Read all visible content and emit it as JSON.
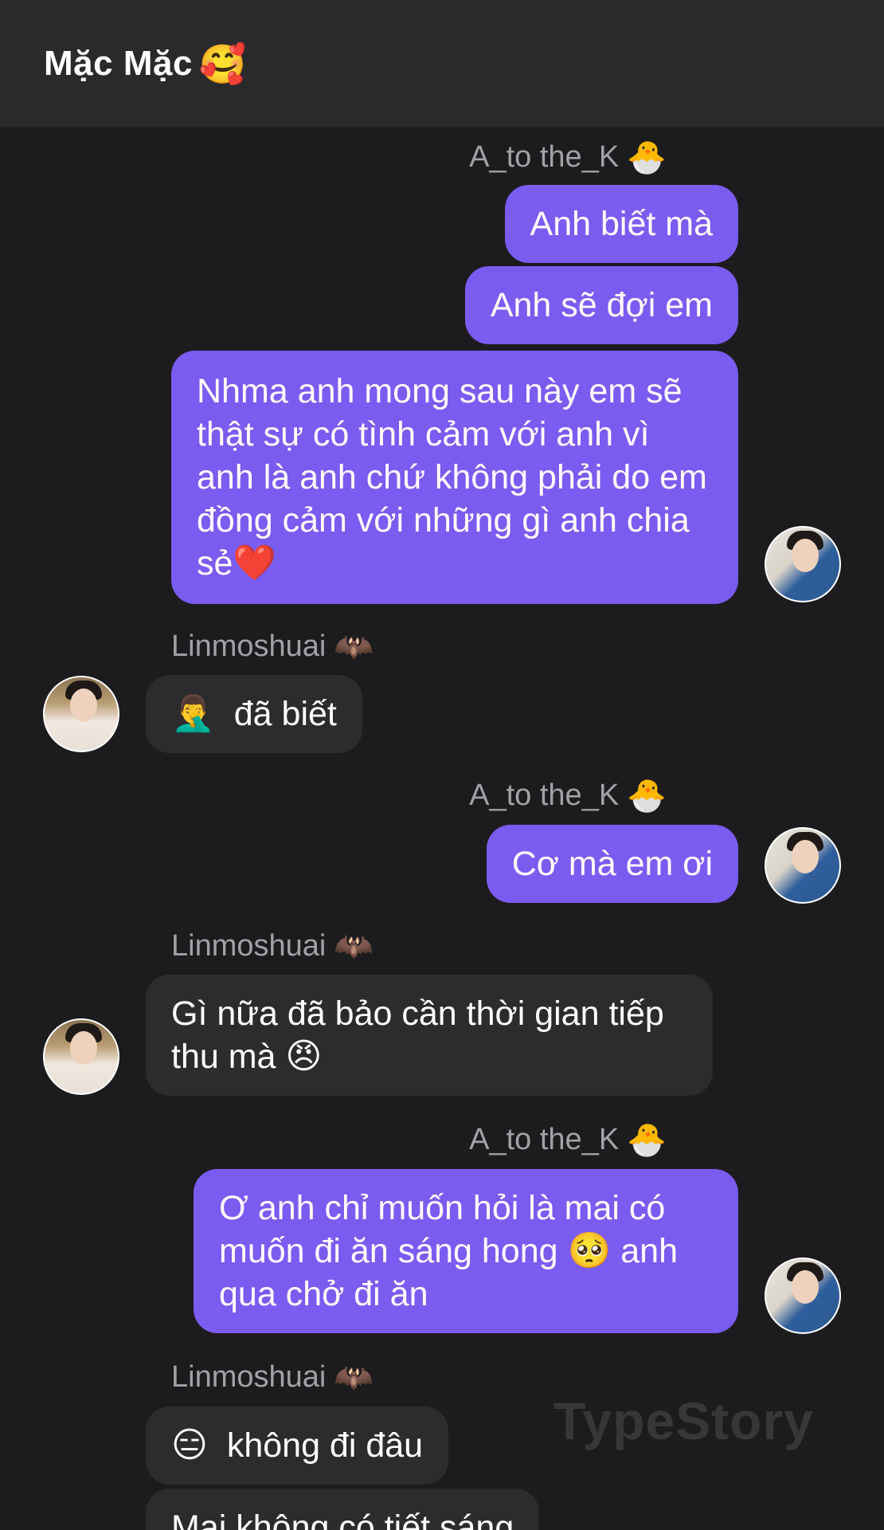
{
  "header": {
    "title": "Mặc Mặc",
    "emoji": "🥰"
  },
  "participants": {
    "me": {
      "name": "A_to the_K",
      "emoji": "🐣"
    },
    "them": {
      "name": "Linmoshuai",
      "emoji": "🦇"
    }
  },
  "messages": [
    {
      "sender": "me",
      "text": "Anh biết mà"
    },
    {
      "sender": "me",
      "text": "Anh sẽ đợi em"
    },
    {
      "sender": "me",
      "text": "Nhma anh mong sau này em sẽ thật sự có tình cảm với anh vì anh là anh chứ không phải do em đồng cảm với những gì anh chia sẻ",
      "emoji_end": "❤️"
    },
    {
      "sender": "them",
      "emoji_start": "🤦‍♂️",
      "text": "đã biết"
    },
    {
      "sender": "me",
      "text": "Cơ mà em ơi"
    },
    {
      "sender": "them",
      "text": "Gì nữa đã bảo cần thời gian tiếp thu mà",
      "emoji_end": "😠"
    },
    {
      "sender": "me",
      "text_before": "Ơ anh chỉ muốn hỏi là mai có muốn đi ăn sáng hong",
      "emoji_mid": "🥺",
      "text_after": "anh qua chở đi ăn"
    },
    {
      "sender": "them",
      "emoji_start": "😑",
      "text": "không đi đâu"
    },
    {
      "sender": "them",
      "text": "Mai không có tiết sáng"
    }
  ],
  "watermark": "TypeStory"
}
